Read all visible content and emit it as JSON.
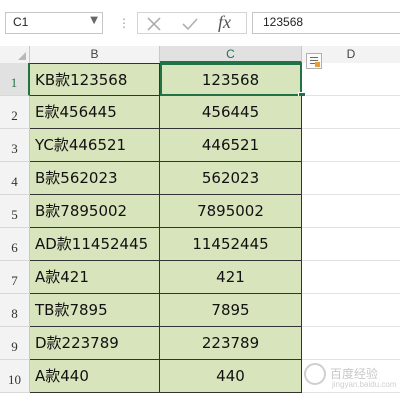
{
  "name_box": {
    "value": "C1"
  },
  "formula_bar": {
    "fx_label": "fx",
    "value": "123568"
  },
  "columns": [
    {
      "key": "B",
      "label": "B",
      "active": false
    },
    {
      "key": "C",
      "label": "C",
      "active": true
    },
    {
      "key": "D",
      "label": "D",
      "active": false
    }
  ],
  "rows": [
    {
      "row": "1",
      "b": "KB款123568",
      "c": "123568"
    },
    {
      "row": "2",
      "b": "E款456445",
      "c": "456445"
    },
    {
      "row": "3",
      "b": "YC款446521",
      "c": "446521"
    },
    {
      "row": "4",
      "b": "B款562023",
      "c": "562023"
    },
    {
      "row": "5",
      "b": "B款7895002",
      "c": "7895002"
    },
    {
      "row": "6",
      "b": "AD款11452445",
      "c": "11452445"
    },
    {
      "row": "7",
      "b": "A款421",
      "c": "421"
    },
    {
      "row": "8",
      "b": "TB款7895",
      "c": "7895"
    },
    {
      "row": "9",
      "b": "D款223789",
      "c": "223789"
    },
    {
      "row": "10",
      "b": "A款440",
      "c": "440"
    }
  ],
  "selected_cell": "C1",
  "colors": {
    "data_fill": "#d8e4bc",
    "selection": "#217346"
  },
  "watermark": {
    "text": "百度经验",
    "sub": "jingyan.baidu.com"
  }
}
